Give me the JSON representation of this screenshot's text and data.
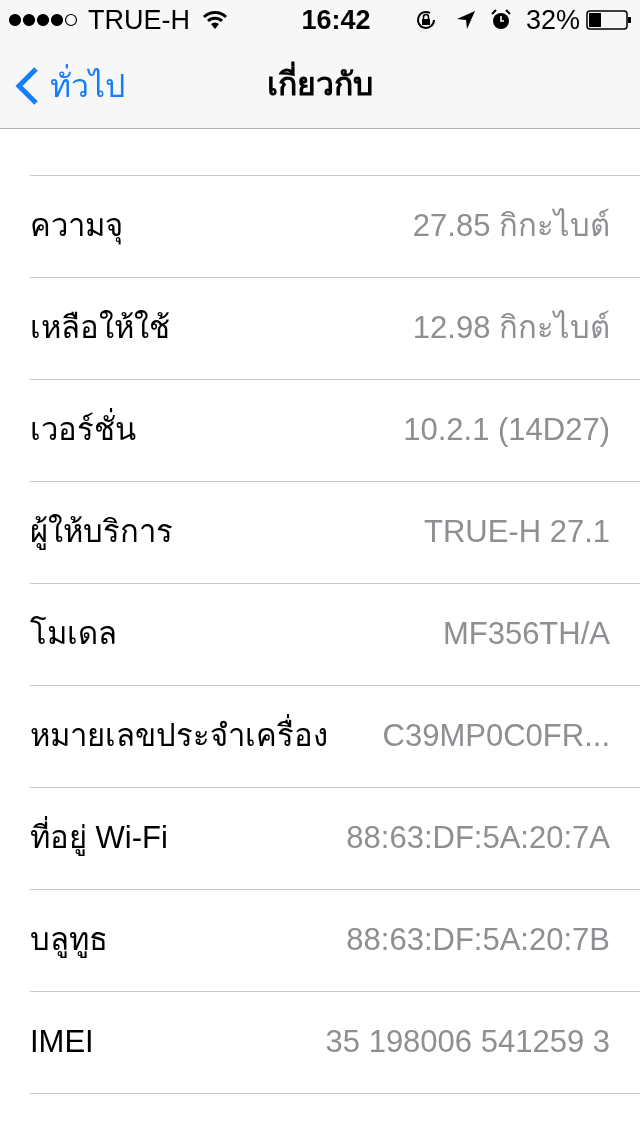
{
  "status_bar": {
    "carrier": "TRUE-H",
    "time": "16:42",
    "battery": "32%"
  },
  "nav": {
    "back": "ทั่วไป",
    "title": "เกี่ยวกับ"
  },
  "rows": [
    {
      "label": "ความจุ",
      "value": "27.85 กิกะไบต์"
    },
    {
      "label": "เหลือให้ใช้",
      "value": "12.98 กิกะไบต์"
    },
    {
      "label": "เวอร์ชั่น",
      "value": "10.2.1 (14D27)"
    },
    {
      "label": "ผู้ให้บริการ",
      "value": "TRUE-H 27.1"
    },
    {
      "label": "โมเดล",
      "value": "MF356TH/A"
    },
    {
      "label": "หมายเลขประจำเครื่อง",
      "value": "C39MP0C0FR..."
    },
    {
      "label": "ที่อยู่ Wi-Fi",
      "value": "88:63:DF:5A:20:7A"
    },
    {
      "label": "บลูทูธ",
      "value": "88:63:DF:5A:20:7B"
    },
    {
      "label": "IMEI",
      "value": "35 198006 541259 3"
    }
  ]
}
